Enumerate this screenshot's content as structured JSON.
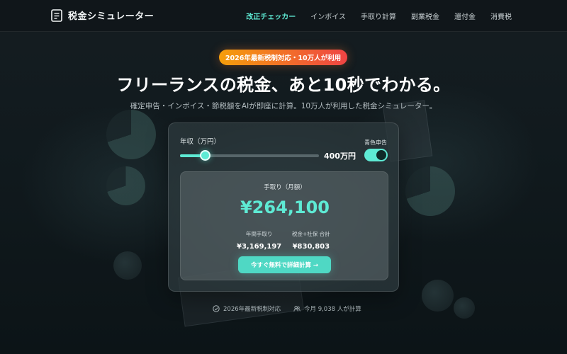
{
  "header": {
    "logo_text": "税金シミュレーター",
    "nav": [
      {
        "label": "改正チェッカー",
        "active": true
      },
      {
        "label": "インボイス",
        "active": false
      },
      {
        "label": "手取り計算",
        "active": false
      },
      {
        "label": "副業税金",
        "active": false
      },
      {
        "label": "還付金",
        "active": false
      },
      {
        "label": "消費税",
        "active": false
      }
    ]
  },
  "hero": {
    "badge": "2026年最新税制対応・10万人が利用",
    "title": "フリーランスの税金、あと10秒でわかる。",
    "subtitle": "確定申告・インボイス・節税額をAIが即座に計算。10万人が利用した税金シミュレーター。"
  },
  "calculator": {
    "income_label": "年収（万円）",
    "income_value": "400万円",
    "slider_fraction": 0.18,
    "toggle_label": "青色申告",
    "toggle_on": true,
    "result_label": "手取り（月額）",
    "result_amount": "¥264,100",
    "stats": [
      {
        "label": "年間手取り",
        "value": "¥3,169,197"
      },
      {
        "label": "税金+社保 合計",
        "value": "¥830,803"
      }
    ],
    "cta_label": "今すぐ無料で詳細計算 →"
  },
  "trust": [
    {
      "icon": "check-circle-icon",
      "text": "2026年最新税制対応"
    },
    {
      "icon": "users-icon",
      "text": "今月 9,038 人が計算"
    }
  ],
  "colors": {
    "accent": "#5eead4",
    "badge_start": "#f59e0b",
    "badge_end": "#ef4444"
  }
}
